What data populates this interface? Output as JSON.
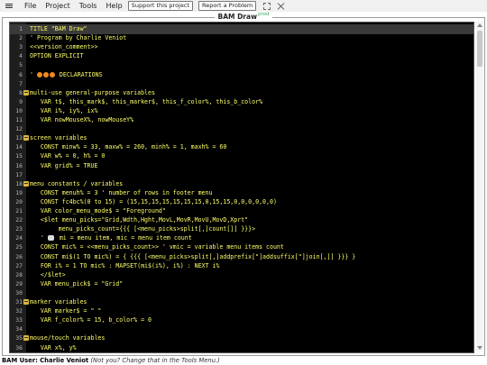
{
  "menubar": {
    "items": [
      "File",
      "Project",
      "Tools",
      "Help"
    ],
    "buttons": [
      "Support this project",
      "Report a Problem"
    ]
  },
  "window": {
    "title": "BAM Draw",
    "badge": "prod"
  },
  "editor": {
    "current_line": 1,
    "lines": [
      {
        "n": 1,
        "text": "TITLE \"BAM Draw\""
      },
      {
        "n": 2,
        "text": "' Program by Charlie Veniot"
      },
      {
        "n": 3,
        "text": "<<version_comment>>"
      },
      {
        "n": 4,
        "text": "OPTION EXPLICIT"
      },
      {
        "n": 5,
        "text": ""
      },
      {
        "n": 6,
        "text": "' ●●● DECLARATIONS",
        "dots": 3,
        "label": " DECLARATIONS"
      },
      {
        "n": 7,
        "text": ""
      },
      {
        "n": 8,
        "text": "' multi-use general-purpose variables",
        "fold": true
      },
      {
        "n": 9,
        "text": "   VAR t$, this_mark$, this_marker$, this_f_color%, this_b_color%"
      },
      {
        "n": 10,
        "text": "   VAR i%, iy%, ix%"
      },
      {
        "n": 11,
        "text": "   VAR nowMouseX%, nowMouseY%"
      },
      {
        "n": 12,
        "text": ""
      },
      {
        "n": 13,
        "text": "' screen variables",
        "fold": true
      },
      {
        "n": 14,
        "text": "   CONST minw% = 33, maxw% = 260, minh% = 1, maxh% = 60"
      },
      {
        "n": 15,
        "text": "   VAR w% = 0, h% = 0"
      },
      {
        "n": 16,
        "text": "   VAR grid% = TRUE"
      },
      {
        "n": 17,
        "text": ""
      },
      {
        "n": 18,
        "text": "' menu constants / variables",
        "fold": true
      },
      {
        "n": 19,
        "text": "   CONST menuh% = 3 ' number of rows in footer menu"
      },
      {
        "n": 20,
        "text": "   CONST fc4bc%(0 to 15) = (15,15,15,15,15,15,15,0,15,15,0,0,0,0,0,0)"
      },
      {
        "n": 21,
        "text": "   VAR color_menu_mode$ = \"Foreground\""
      },
      {
        "n": 22,
        "text": "   <$let menu_picks=\"Grid,Wdth,Hght,MovL,MovR,MovU,MovD,Xprt\""
      },
      {
        "n": 23,
        "text": "        menu_picks_count={{{ [<menu_picks>split[,]count[]] }}}>"
      },
      {
        "n": 24,
        "text": "   '   mi = menu item, mic = menu item count",
        "bubble": true,
        "label": " mi = menu item, mic = menu item count"
      },
      {
        "n": 25,
        "text": "   CONST mic% = <<menu_picks_count>> ' vmic = variable menu items count"
      },
      {
        "n": 26,
        "text": "   CONST mi$(1 TO mic%) = { {{{ [<menu_picks>split[,]addprefix[\"]addsuffix[\"]join[,]] }}} }"
      },
      {
        "n": 27,
        "text": "   FOR i% = 1 TO mic% : MAPSET(mi$(i%), i%) : NEXT i%"
      },
      {
        "n": 28,
        "text": "   </$let>"
      },
      {
        "n": 29,
        "text": "   VAR menu_pick$ = \"Grid\""
      },
      {
        "n": 30,
        "text": ""
      },
      {
        "n": 31,
        "text": "' marker variables",
        "fold": true
      },
      {
        "n": 32,
        "text": "   VAR marker$ = \" \""
      },
      {
        "n": 33,
        "text": "   VAR f_color% = 15, b_color% = 0"
      },
      {
        "n": 34,
        "text": ""
      },
      {
        "n": 35,
        "text": "' mouse/touch variables",
        "fold": true
      },
      {
        "n": 36,
        "text": "   VAR x%, y%"
      }
    ]
  },
  "status": {
    "user_label": "BAM User: Charlie Veniot",
    "hint": "(Not you? Change that in the Tools Menu.)"
  }
}
